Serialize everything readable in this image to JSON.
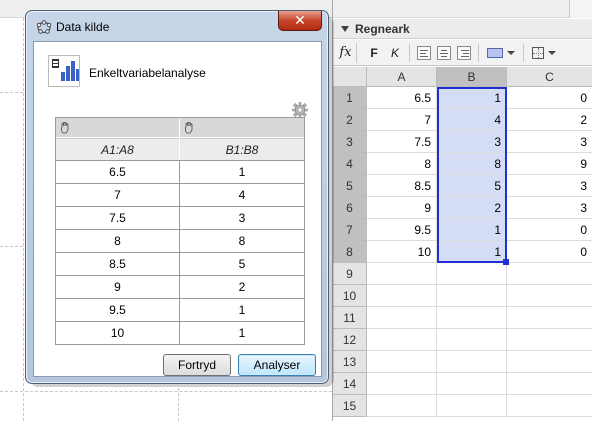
{
  "dialog": {
    "title": "Data kilde",
    "close_label": "✕",
    "analysis_type": "Enkeltvariabelanalyse",
    "icons": {
      "window": "geogebra-window-icon",
      "analysis": "one-variable-analysis-icon",
      "settings": "gear-icon",
      "drag": "hand-icon"
    },
    "table": {
      "columns": [
        {
          "range": "A1:A8"
        },
        {
          "range": "B1:B8"
        }
      ],
      "rows": [
        [
          "6.5",
          "1"
        ],
        [
          "7",
          "4"
        ],
        [
          "7.5",
          "3"
        ],
        [
          "8",
          "8"
        ],
        [
          "8.5",
          "5"
        ],
        [
          "9",
          "2"
        ],
        [
          "9.5",
          "1"
        ],
        [
          "10",
          "1"
        ]
      ]
    },
    "buttons": {
      "cancel": "Fortryd",
      "analyze": "Analyser"
    }
  },
  "spreadsheet": {
    "title": "Regneark",
    "toolbar": {
      "fx": "fx",
      "bold": "F",
      "italic": "K"
    },
    "colors": {
      "selection_fill": "#d5dcf5",
      "selection_border": "#1f2fd1"
    },
    "columns": [
      "A",
      "B",
      "C"
    ],
    "row_numbers": [
      "1",
      "2",
      "3",
      "4",
      "5",
      "6",
      "7",
      "8",
      "9",
      "10",
      "11",
      "12",
      "13",
      "14",
      "15"
    ],
    "cells": [
      [
        "6.5",
        "1",
        "0"
      ],
      [
        "7",
        "4",
        "2"
      ],
      [
        "7.5",
        "3",
        "3"
      ],
      [
        "8",
        "8",
        "9"
      ],
      [
        "8.5",
        "5",
        "3"
      ],
      [
        "9",
        "2",
        "3"
      ],
      [
        "9.5",
        "1",
        "0"
      ],
      [
        "10",
        "1",
        "0"
      ],
      [
        "",
        "",
        ""
      ],
      [
        "",
        "",
        ""
      ],
      [
        "",
        "",
        ""
      ],
      [
        "",
        "",
        ""
      ],
      [
        "",
        "",
        ""
      ],
      [
        "",
        "",
        ""
      ],
      [
        "",
        "",
        ""
      ]
    ]
  }
}
